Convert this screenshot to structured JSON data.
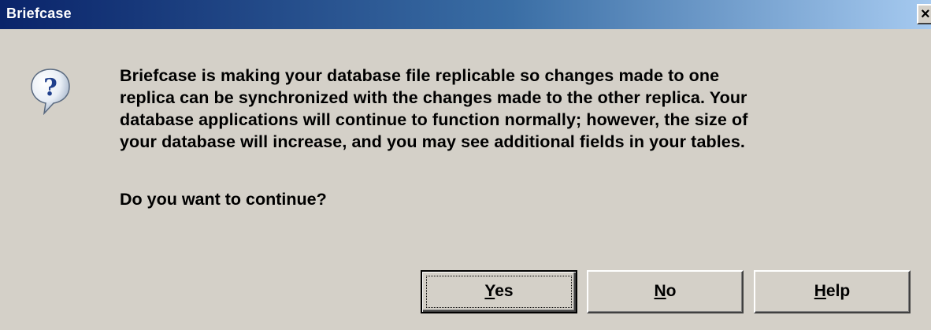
{
  "window": {
    "title": "Briefcase",
    "close_glyph": "×"
  },
  "icon": {
    "name": "question-icon",
    "glyph": "?"
  },
  "message": {
    "lines": [
      "Briefcase is making your database file replicable so changes made to one",
      "replica can be synchronized with the changes made to the other replica. Your",
      "database applications will continue to function normally; however, the size of",
      "your database will increase, and you may see additional fields in your tables."
    ],
    "question": "Do you want to continue?"
  },
  "buttons": {
    "yes": {
      "mnemonic": "Y",
      "rest": "es"
    },
    "no": {
      "mnemonic": "N",
      "rest": "o"
    },
    "help": {
      "mnemonic": "H",
      "rest": "elp"
    }
  },
  "colors": {
    "title_bar_start": "#0a246a",
    "title_bar_end": "#a6caf0",
    "dialog_face": "#d4d0c8"
  }
}
